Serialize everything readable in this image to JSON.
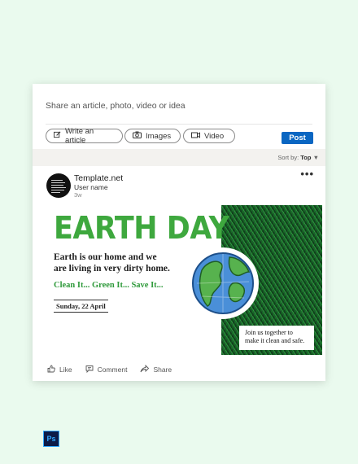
{
  "share": {
    "placeholder": "Share an article, photo, video or idea",
    "write_label": "Write an article",
    "images_label": "Images",
    "video_label": "Video",
    "post_label": "Post"
  },
  "feed": {
    "sort_prefix": "Sort by:",
    "sort_value": "Top"
  },
  "post": {
    "author": "Template.net",
    "username": "User name",
    "time": "3w",
    "headline": "EARTH DAY",
    "body_line1": "Earth is our home and we",
    "body_line2": "are living in very dirty home.",
    "clean_text": "Clean It... Green It... Save It...",
    "date": "Sunday, 22 April",
    "note_line1": "Join us together to",
    "note_line2": "make it clean and safe."
  },
  "actions": {
    "like": "Like",
    "comment": "Comment",
    "share": "Share"
  },
  "badge": {
    "ps": "Ps"
  },
  "colors": {
    "page_bg": "#eafaee",
    "accent_blue": "#0a66c2",
    "headline_green": "#3ea83e",
    "grass_green": "#2f8c41"
  }
}
